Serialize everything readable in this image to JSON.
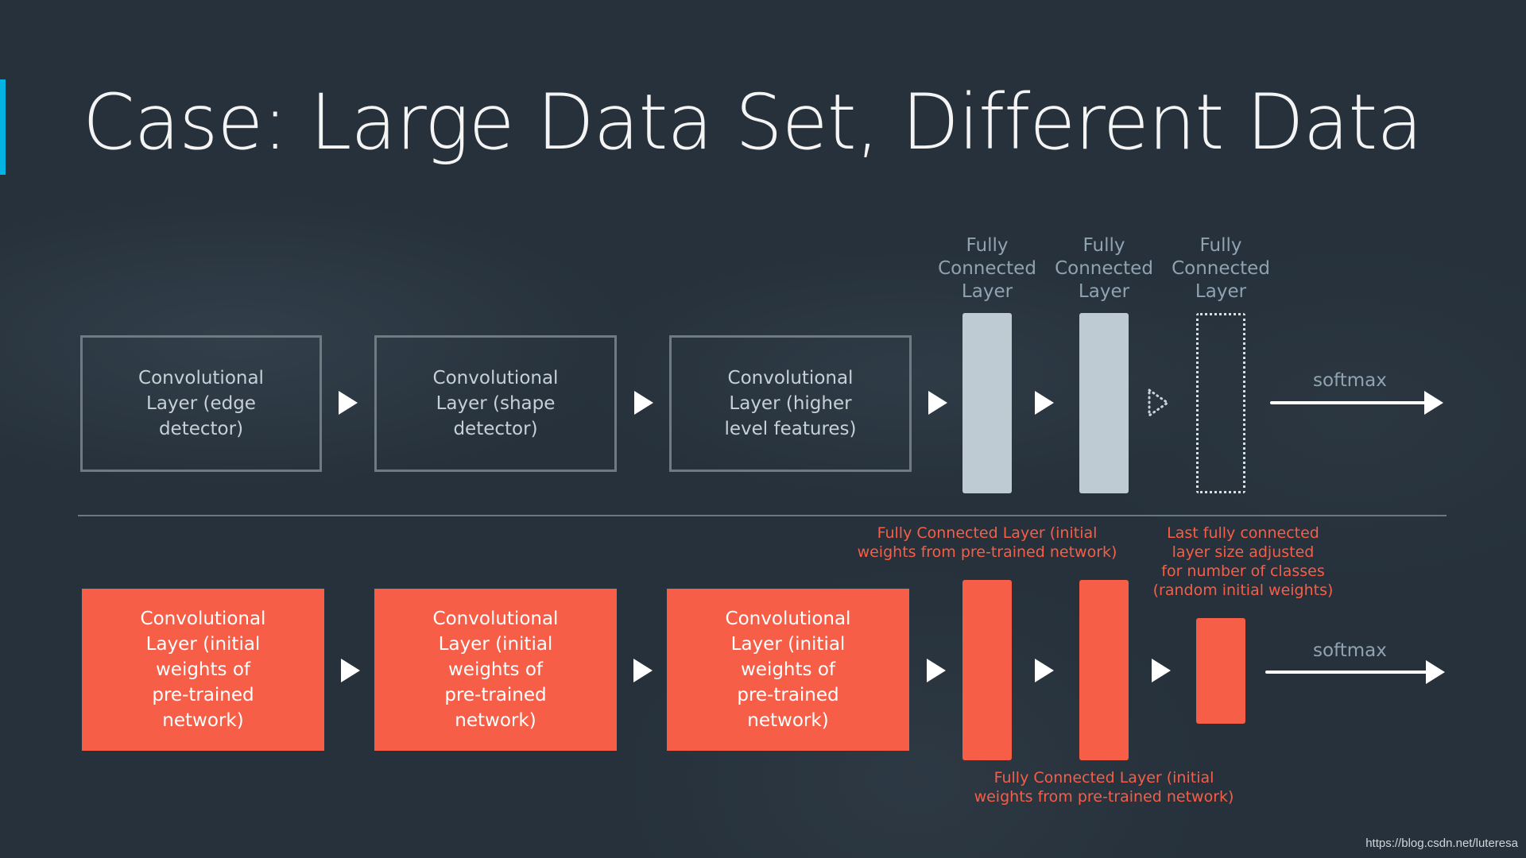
{
  "slide": {
    "title": "Case: Large Data Set, Different Data",
    "accent_color": "#02b3e4",
    "background_color": "#26313b"
  },
  "top_row": {
    "conv_layers": [
      {
        "label": "Convolutional\nLayer (edge\ndetector)"
      },
      {
        "label": "Convolutional\nLayer (shape\ndetector)"
      },
      {
        "label": "Convolutional\nLayer (higher\nlevel features)"
      }
    ],
    "fc_layers": [
      {
        "label": "Fully\nConnected\nLayer",
        "style": "solid"
      },
      {
        "label": "Fully\nConnected\nLayer",
        "style": "solid"
      },
      {
        "label": "Fully\nConnected\nLayer",
        "style": "dotted"
      }
    ],
    "softmax_label": "softmax",
    "colors": {
      "outline": "#6f7a83",
      "fc_fill": "#bfcbd3",
      "label": "#8fa3b1"
    }
  },
  "bottom_row": {
    "conv_layers": [
      {
        "label": "Convolutional\nLayer (initial\nweights of\npre-trained\nnetwork)"
      },
      {
        "label": "Convolutional\nLayer (initial\nweights of\npre-trained\nnetwork)"
      },
      {
        "label": "Convolutional\nLayer (initial\nweights of\npre-trained\nnetwork)"
      }
    ],
    "annotations": {
      "fc_top": "Fully Connected Layer (initial\nweights from pre-trained network)",
      "last_fc": "Last fully connected\nlayer size adjusted\nfor number of classes\n(random initial weights)",
      "fc_bottom": "Fully Connected Layer (initial\nweights from pre-trained network)"
    },
    "softmax_label": "softmax",
    "colors": {
      "fill": "#f65e47",
      "annotation": "#f65e47"
    }
  },
  "watermark": "https://blog.csdn.net/luteresa"
}
